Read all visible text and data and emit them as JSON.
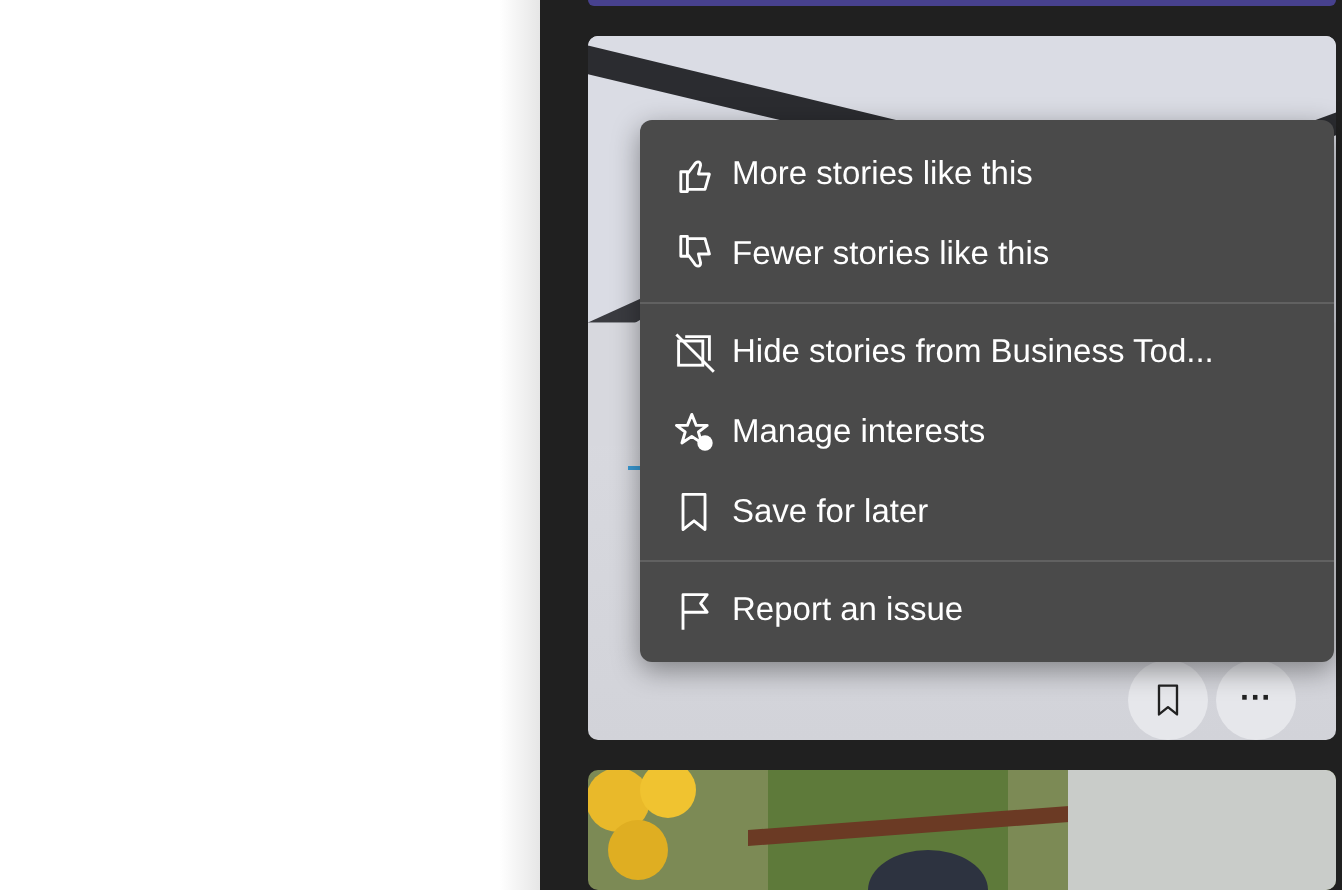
{
  "card_actions": [
    {
      "kind": "bookmark"
    },
    {
      "kind": "more",
      "label": "···"
    }
  ],
  "menu": {
    "groups": [
      {
        "items": [
          {
            "label": "More stories like this"
          },
          {
            "label": "Fewer stories like this"
          }
        ]
      },
      {
        "items": [
          {
            "label": "Hide stories from Business Tod..."
          },
          {
            "label": "Manage interests"
          },
          {
            "label": "Save for later"
          }
        ]
      },
      {
        "items": [
          {
            "label": "Report an issue"
          }
        ]
      }
    ]
  }
}
